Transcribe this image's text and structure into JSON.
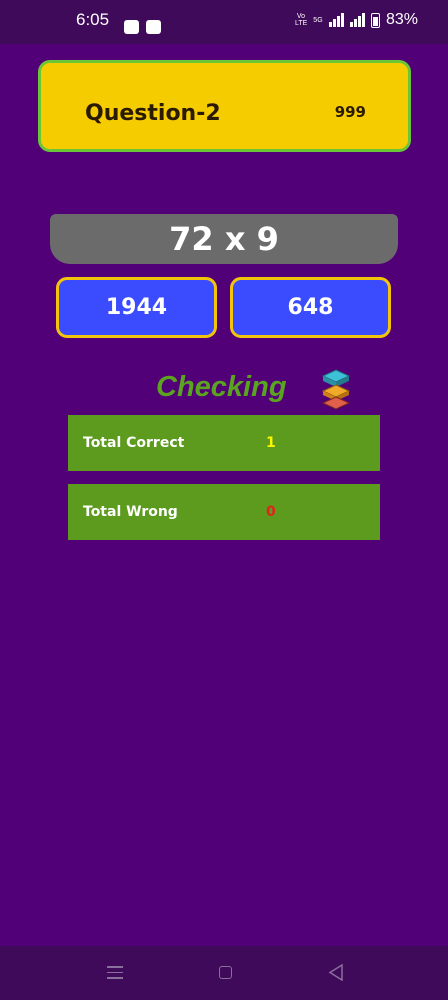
{
  "status_bar": {
    "time": "6:05",
    "volte_label": "Vo LTE",
    "network_label": "5G",
    "battery_percent": "83%",
    "icons": [
      "notification-icon",
      "paytm-icon",
      "signal-icon",
      "battery-icon"
    ]
  },
  "question": {
    "title": "Question-2",
    "timer": "999"
  },
  "problem": {
    "expression": "72 x 9"
  },
  "answers": [
    {
      "label": "1944"
    },
    {
      "label": "648"
    }
  ],
  "checking": {
    "label": "Checking"
  },
  "score": {
    "correct_label": "Total Correct",
    "correct_value": "1",
    "wrong_label": "Total Wrong",
    "wrong_value": "0"
  },
  "colors": {
    "background": "#520078",
    "card": "#f5cc00",
    "card_border": "#6bc637",
    "answer": "#3b4cff",
    "answer_border": "#f2c40c",
    "score_row": "#5c9b1e",
    "correct_value": "#f7f700",
    "wrong_value": "#e0241b"
  },
  "nav_bar": {
    "icons": [
      "menu-icon",
      "home-icon",
      "back-icon"
    ]
  }
}
